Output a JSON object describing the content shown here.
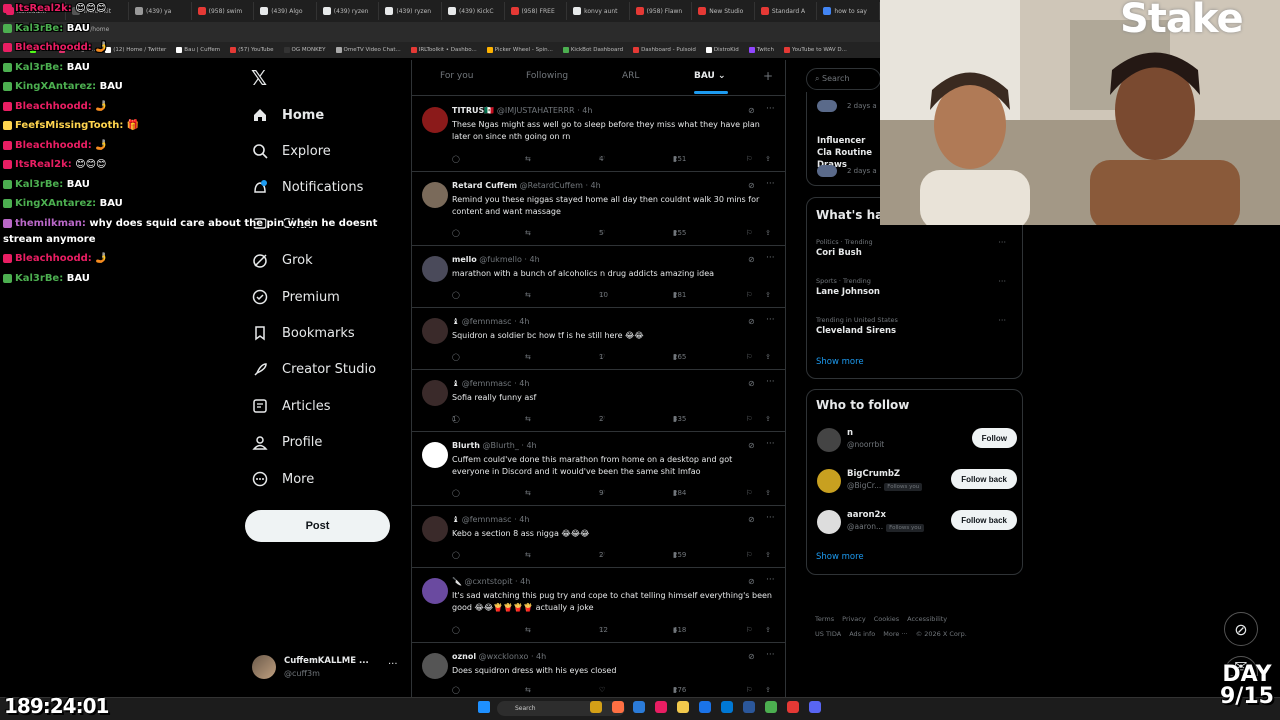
{
  "browser": {
    "tabs": [
      "ItsReal2k:",
      "IRLToolkit",
      "(439) ya",
      "(958) swim",
      "(439) Algo",
      "(439) ryzen",
      "(439) ryzen",
      "(439) KickC",
      "(958) FREE",
      "konvy aunt",
      "(958) Flawn",
      "New Studio",
      "Standard A",
      "how to say"
    ],
    "url": "x.com/home",
    "bookmarks": [
      "Kick",
      "Instagra...",
      "(12) Home / Twitter",
      "Bau | Cuffem",
      "(57) YouTube",
      "OG MONKEY",
      "OmeTV Video Chat...",
      "IRLToolkit • Dashbo...",
      "Picker Wheel - Spin...",
      "KickBot Dashboard",
      "Dashboard - Pulsoid",
      "DistroKid",
      "Twitch",
      "YouTube to WAV D..."
    ]
  },
  "nav": {
    "items": [
      {
        "label": "Home",
        "icon": "home-icon"
      },
      {
        "label": "Explore",
        "icon": "search-icon"
      },
      {
        "label": "Notifications",
        "icon": "bell-icon"
      },
      {
        "label": "Chat",
        "icon": "chat-icon"
      },
      {
        "label": "Grok",
        "icon": "grok-icon"
      },
      {
        "label": "Premium",
        "icon": "premium-icon"
      },
      {
        "label": "Bookmarks",
        "icon": "bookmark-icon"
      },
      {
        "label": "Creator Studio",
        "icon": "rocket-icon"
      },
      {
        "label": "Articles",
        "icon": "article-icon"
      },
      {
        "label": "Profile",
        "icon": "person-icon"
      },
      {
        "label": "More",
        "icon": "more-icon"
      }
    ],
    "post_label": "Post",
    "account": {
      "name": "CuffemKALLME ...",
      "handle": "@cuff3m"
    }
  },
  "feed": {
    "tabs": [
      "For you",
      "Following",
      "ARL",
      "BAU ⌄"
    ],
    "selected_tab": "BAU",
    "plus": "+",
    "tweets": [
      {
        "name": "TITRUS🇲🇽",
        "handle": "@IMJUSTAHATERRR",
        "time": "· 4h",
        "text": "These Ngas might ass well go to sleep before they miss what they have plan later on  since nth going on rn",
        "replies": "",
        "retweets": "",
        "likes": "4",
        "views": "251",
        "avatar": "#8b1a1a"
      },
      {
        "name": "Retard Cuffem",
        "handle": "@RetardCuffem",
        "time": "· 4h",
        "text": "Remind you these niggas stayed home all day then couldnt walk 30 mins for content and want massage",
        "replies": "",
        "retweets": "",
        "likes": "5",
        "views": "255",
        "avatar": "#7a6a5a"
      },
      {
        "name": "mello",
        "handle": "@fukmello",
        "time": "· 4h",
        "text": "marathon with a bunch of alcoholics n drug addicts amazing idea",
        "replies": "",
        "retweets": "",
        "likes": "10",
        "views": "281",
        "avatar": "#4a4a5a"
      },
      {
        "name": "♝",
        "handle": "@femnmasc",
        "time": "· 4h",
        "text": "Squidron a soldier bc how tf is he still here 😂😂",
        "replies": "",
        "retweets": "",
        "likes": "1",
        "views": "265",
        "avatar": "#3a2a2a"
      },
      {
        "name": "♝",
        "handle": "@femnmasc",
        "time": "· 4h",
        "text": "Sofia really funny asf",
        "replies": "1",
        "retweets": "",
        "likes": "2",
        "views": "335",
        "avatar": "#3a2a2a"
      },
      {
        "name": "Blurth",
        "handle": "@Blurth_",
        "time": "· 4h",
        "text": "Cuffem could've done this marathon from home on a desktop and got everyone in Discord and it would've been the same shit lmfao",
        "replies": "",
        "retweets": "",
        "likes": "9",
        "views": "284",
        "avatar": "#ffffff"
      },
      {
        "name": "♝",
        "handle": "@femnmasc",
        "time": "· 4h",
        "text": "Kebo a section 8 ass nigga 😂😂😂",
        "replies": "",
        "retweets": "",
        "likes": "2",
        "views": "259",
        "avatar": "#3a2a2a"
      },
      {
        "name": "🔪",
        "handle": "@cxntstopit",
        "time": "· 4h",
        "text": "It's sad watching this pug try and cope to chat telling himself everything's been good 😂😂🍟🍟🍟🍟 actually a joke",
        "replies": "",
        "retweets": "",
        "likes": "12",
        "views": "418",
        "avatar": "#6a4aa0"
      },
      {
        "name": "oznol",
        "handle": "@wxcklonxo",
        "time": "· 4h",
        "text": "Does squidron dress with his eyes closed",
        "replies": "",
        "retweets": "",
        "likes": "",
        "views": "276",
        "avatar": "#555555"
      }
    ]
  },
  "right": {
    "search_placeholder": "Search",
    "partial_items": [
      {
        "title": "",
        "meta": "2 days a"
      },
      {
        "title": "Influencer Cla Routine Draws",
        "meta": "2 days a"
      }
    ],
    "whats_happening": "What's hap",
    "trends": [
      {
        "meta": "Politics · Trending",
        "title": "Cori Bush"
      },
      {
        "meta": "Sports · Trending",
        "title": "Lane Johnson"
      },
      {
        "meta": "Trending in United States",
        "title": "Cleveland Sirens"
      }
    ],
    "show_more": "Show more",
    "who_to_follow": "Who to follow",
    "follow": [
      {
        "name": "n",
        "handle": "@noorrbit",
        "follows_you": "",
        "button": "Follow"
      },
      {
        "name": "BigCrumbZ",
        "handle": "@BigCr...",
        "follows_you": "Follows you",
        "button": "Follow back"
      },
      {
        "name": "aaron2x",
        "handle": "@aaron...",
        "follows_you": "Follows you",
        "button": "Follow back"
      }
    ],
    "show_more_2": "Show more",
    "footer": [
      "Terms",
      "Privacy",
      "Cookies",
      "Accessibility",
      "US TIDA",
      "Ads info",
      "More ···",
      "© 2026 X Corp."
    ]
  },
  "chat": [
    {
      "user": "ItsReal2k:",
      "msg": "😊😊😊",
      "color": "#e91e63"
    },
    {
      "user": "Kal3rBe:",
      "msg": "BAU",
      "color": "#4caf50"
    },
    {
      "user": "Bleachhoodd:",
      "msg": "🤳",
      "color": "#e91e63"
    },
    {
      "user": "Kal3rBe:",
      "msg": "BAU",
      "color": "#4caf50"
    },
    {
      "user": "KingXAntarez:",
      "msg": "BAU",
      "color": "#4caf50"
    },
    {
      "user": "Bleachhoodd:",
      "msg": "🤳",
      "color": "#e91e63"
    },
    {
      "user": "FeefsMissingTooth:",
      "msg": "🎁",
      "color": "#ffd54f"
    },
    {
      "user": "Bleachhoodd:",
      "msg": "🤳",
      "color": "#e91e63"
    },
    {
      "user": "ItsReal2k:",
      "msg": "😊😊😊",
      "color": "#e91e63"
    },
    {
      "user": "Kal3rBe:",
      "msg": "BAU",
      "color": "#4caf50"
    },
    {
      "user": "KingXAntarez:",
      "msg": "BAU",
      "color": "#4caf50"
    },
    {
      "user": "themilkman:",
      "msg": "why does squid care about the pin when he doesnt",
      "color": "#ba68c8"
    },
    {
      "user": "",
      "msg": "stream anymore",
      "color": "#ffffff"
    },
    {
      "user": "Bleachhoodd:",
      "msg": "🤳",
      "color": "#e91e63"
    },
    {
      "user": "Kal3rBe:",
      "msg": "BAU",
      "color": "#4caf50"
    }
  ],
  "overlay": {
    "stake_logo": "Stake",
    "timer": "189:24:01",
    "day_label": "DAY",
    "day_value": "9/15"
  },
  "taskbar": {
    "search_placeholder": "Search"
  }
}
